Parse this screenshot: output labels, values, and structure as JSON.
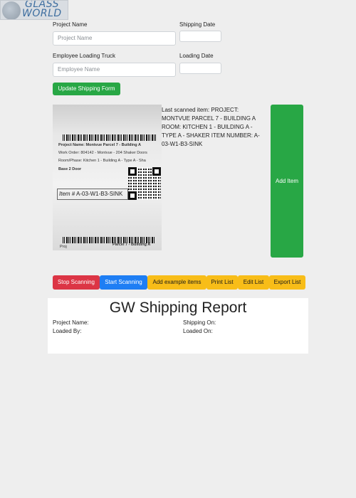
{
  "logo": {
    "line1": "GLASS",
    "line2": "WORLD"
  },
  "form": {
    "project_name_label": "Project Name",
    "project_name_placeholder": "Project Name",
    "shipping_date_label": "Shipping Date",
    "employee_label": "Employee Loading Truck",
    "employee_placeholder": "Employee Name",
    "loading_date_label": "Loading Date",
    "update_button": "Update Shipping Form"
  },
  "scan_image": {
    "project_line": "Project Name: Montvue Parcel 7 - Building A",
    "work_order_line": "Work Order: 804142 - Montvue - 204 Shaker Doors",
    "room_line": "Room/Phase: Kitchen 1 - Building A - Type A - Sha",
    "base_line": "Base 2 Door",
    "item_label": "Item #",
    "item_number": "A-03-W1-B3-SINK",
    "bottom_left": "Proj",
    "bottom_right": "Parcel 7 - Building A"
  },
  "scanned": {
    "text": "Last scanned item: PROJECT: MONTVUE PARCEL 7 - BUILDING A ROOM: KITCHEN 1 - BUILDING A - TYPE A - SHAKER ITEM NUMBER: A-03-W1-B3-SINK"
  },
  "add_item_button": "Add Item",
  "toolbar": {
    "stop": "Stop Scanning",
    "start": "Start Scanning",
    "add_examples": "Add example items",
    "print": "Print List",
    "edit": "Edit List",
    "export": "Export List"
  },
  "report": {
    "title": "GW Shipping Report",
    "project_name": "Project Name:",
    "loaded_by": "Loaded By:",
    "shipping_on": "Shipping On:",
    "loaded_on": "Loaded On:"
  },
  "colors": {
    "green": "#28a745",
    "red": "#dc3545",
    "blue": "#1e7ef4",
    "yellow": "#f8bd18"
  }
}
